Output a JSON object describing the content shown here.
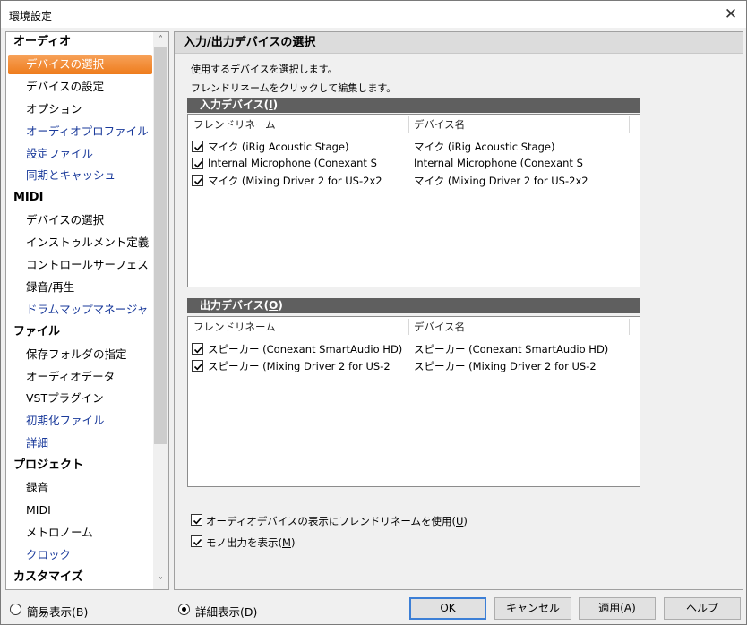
{
  "window": {
    "title": "環境設定",
    "close_label": "✕"
  },
  "sidebar": {
    "items": [
      {
        "label": "オーディオ",
        "type": "cat"
      },
      {
        "label": "デバイスの選択",
        "type": "sub",
        "selected": true
      },
      {
        "label": "デバイスの設定",
        "type": "sub"
      },
      {
        "label": "オプション",
        "type": "sub"
      },
      {
        "label": "オーディオプロファイル",
        "type": "sub",
        "link": true
      },
      {
        "label": "設定ファイル",
        "type": "sub",
        "link": true
      },
      {
        "label": "同期とキャッシュ",
        "type": "sub",
        "link": true
      },
      {
        "label": "MIDI",
        "type": "cat"
      },
      {
        "label": "デバイスの選択",
        "type": "sub"
      },
      {
        "label": "インストゥルメント定義",
        "type": "sub"
      },
      {
        "label": "コントロールサーフェス",
        "type": "sub"
      },
      {
        "label": "録音/再生",
        "type": "sub"
      },
      {
        "label": "ドラムマップマネージャ",
        "type": "sub",
        "link": true
      },
      {
        "label": "ファイル",
        "type": "cat"
      },
      {
        "label": "保存フォルダの指定",
        "type": "sub"
      },
      {
        "label": "オーディオデータ",
        "type": "sub"
      },
      {
        "label": "VSTプラグイン",
        "type": "sub"
      },
      {
        "label": "初期化ファイル",
        "type": "sub",
        "link": true
      },
      {
        "label": "詳細",
        "type": "sub",
        "link": true
      },
      {
        "label": "プロジェクト",
        "type": "cat"
      },
      {
        "label": "録音",
        "type": "sub"
      },
      {
        "label": "MIDI",
        "type": "sub"
      },
      {
        "label": "メトロノーム",
        "type": "sub"
      },
      {
        "label": "クロック",
        "type": "sub",
        "link": true
      },
      {
        "label": "カスタマイズ",
        "type": "cat"
      }
    ]
  },
  "main": {
    "title": "入力/出力デバイスの選択",
    "desc1": "使用するデバイスを選択します。",
    "desc2": "フレンドリネームをクリックして編集します。",
    "input_group": {
      "label": "入力デバイス(",
      "key": "I",
      "suffix": ")"
    },
    "output_group": {
      "label": "出力デバイス(",
      "key": "O",
      "suffix": ")"
    },
    "columns": {
      "friendly": "フレンドリネーム",
      "device": "デバイス名"
    },
    "input_devices": [
      {
        "friendly": "マイク (iRig Acoustic Stage)",
        "device": "マイク (iRig Acoustic Stage)",
        "checked": true
      },
      {
        "friendly": "Internal Microphone (Conexant S",
        "device": "Internal Microphone (Conexant S",
        "checked": true
      },
      {
        "friendly": "マイク (Mixing Driver 2 for US-2x2",
        "device": "マイク (Mixing Driver 2 for US-2x2",
        "checked": true
      }
    ],
    "output_devices": [
      {
        "friendly": "スピーカー (Conexant SmartAudio HD)",
        "device": "スピーカー (Conexant SmartAudio HD)",
        "checked": true
      },
      {
        "friendly": "スピーカー (Mixing Driver 2 for US-2",
        "device": "スピーカー (Mixing Driver 2 for US-2",
        "checked": true
      }
    ],
    "opt_friendly": {
      "label": "オーディオデバイスの表示にフレンドリネームを使用(",
      "key": "U",
      "suffix": ")",
      "checked": true
    },
    "opt_mono": {
      "label": "モノ出力を表示(",
      "key": "M",
      "suffix": ")",
      "checked": true
    }
  },
  "footer": {
    "simple_view": "簡易表示(B)",
    "detail_view": "詳細表示(D)",
    "selected_view": "detail",
    "ok": "OK",
    "cancel": "キャンセル",
    "apply": "適用(A)",
    "help": "ヘルプ"
  },
  "colors": {
    "selection": "#ee7c1c",
    "link": "#1a3a9b",
    "groupbar": "#5f5f5f",
    "default_button_border": "#3c7fd6"
  }
}
